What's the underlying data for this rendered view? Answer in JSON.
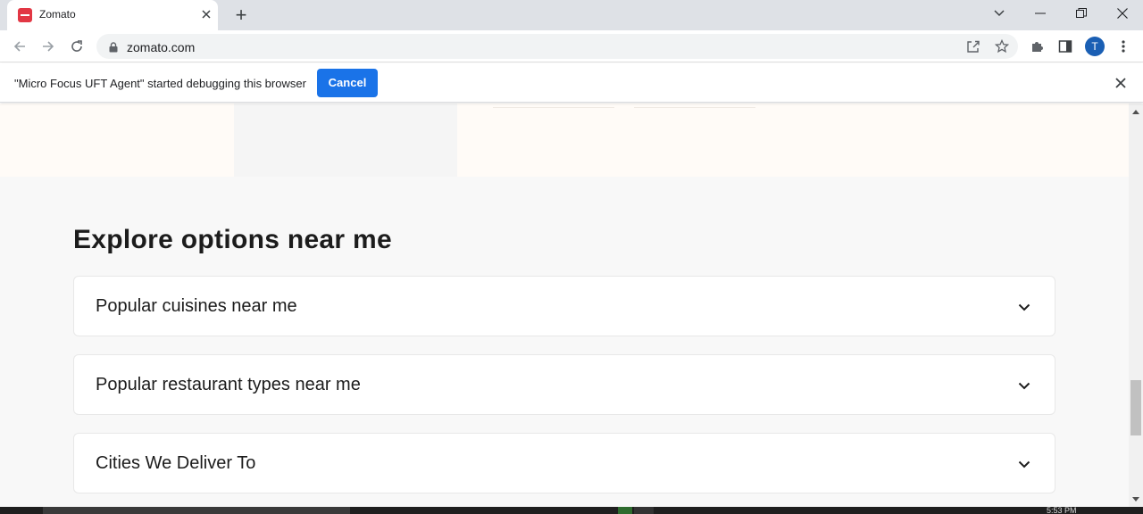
{
  "browser": {
    "tab_title": "Zomato",
    "new_tab": "+",
    "url": "zomato.com",
    "profile_initial": "T"
  },
  "infobar": {
    "message": "\"Micro Focus UFT Agent\" started debugging this browser",
    "cancel_label": "Cancel"
  },
  "main": {
    "section_title": "Explore options near me",
    "accordions": [
      {
        "label": "Popular cuisines near me"
      },
      {
        "label": "Popular restaurant types near me"
      },
      {
        "label": "Cities We Deliver To"
      }
    ]
  },
  "taskbar": {
    "clock": "5:53 PM"
  },
  "colors": {
    "brand": "#e23744",
    "accent": "#1a73e8",
    "profile": "#1a5fb4"
  },
  "icons": [
    "zomato-favicon",
    "close-icon",
    "plus-icon",
    "chevron-down-icon",
    "minimize-icon",
    "restore-icon",
    "back-icon",
    "forward-icon",
    "reload-icon",
    "lock-icon",
    "share-icon",
    "star-icon",
    "puzzle-icon",
    "side-panel-icon",
    "more-icon"
  ]
}
